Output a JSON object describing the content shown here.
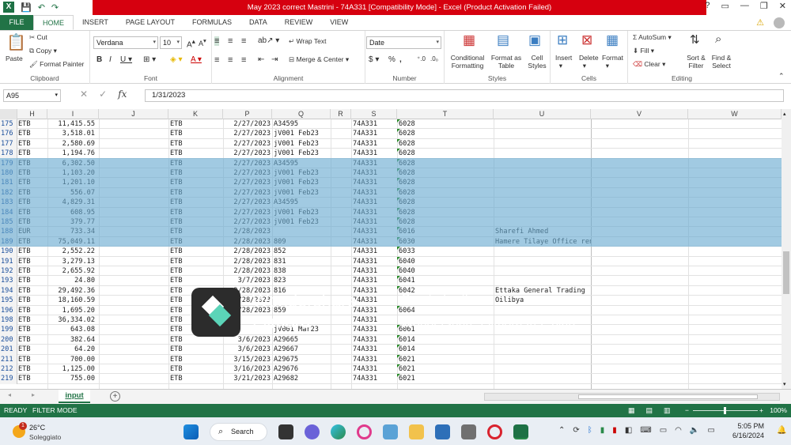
{
  "window": {
    "title": "May 2023 correct Mastrini - 74A331  [Compatibility Mode] - Excel (Product Activation Failed)",
    "controls": [
      "?",
      "▭",
      "—",
      "❐",
      "✕"
    ]
  },
  "tabs": [
    "FILE",
    "HOME",
    "INSERT",
    "PAGE LAYOUT",
    "FORMULAS",
    "DATA",
    "REVIEW",
    "VIEW"
  ],
  "active_tab": "HOME",
  "ribbon": {
    "clipboard": {
      "label": "Clipboard",
      "paste": "Paste",
      "cut": "Cut",
      "copy": "Copy",
      "format_painter": "Format Painter"
    },
    "font": {
      "label": "Font",
      "name": "Verdana",
      "size": "10"
    },
    "alignment": {
      "label": "Alignment",
      "wrap": "Wrap Text",
      "merge": "Merge & Center"
    },
    "number": {
      "label": "Number",
      "format": "Date"
    },
    "styles": {
      "label": "Styles",
      "conditional": "Conditional Formatting",
      "format_table": "Format as Table",
      "cell_styles": "Cell Styles"
    },
    "cells": {
      "label": "Cells",
      "insert": "Insert",
      "delete": "Delete",
      "format": "Format"
    },
    "editing": {
      "label": "Editing",
      "autosum": "AutoSum",
      "fill": "Fill",
      "clear": "Clear",
      "sort": "Sort & Filter",
      "find": "Find & Select"
    }
  },
  "formula_bar": {
    "name_box": "A95",
    "value": "1/31/2023"
  },
  "columns": [
    "H",
    "I",
    "J",
    "K",
    "P",
    "Q",
    "R",
    "S",
    "T",
    "U",
    "V",
    "W"
  ],
  "rows": [
    {
      "n": "175",
      "h": "ETB",
      "i": "11,415.55",
      "k": "ETB",
      "p": "2/27/2023",
      "q": "A34595",
      "s": "74A331",
      "t": "6028",
      "u": ""
    },
    {
      "n": "176",
      "h": "ETB",
      "i": "3,518.01",
      "k": "ETB",
      "p": "2/27/2023",
      "q": "jV001 Feb23",
      "s": "74A331",
      "t": "6028",
      "u": ""
    },
    {
      "n": "177",
      "h": "ETB",
      "i": "2,580.69",
      "k": "ETB",
      "p": "2/27/2023",
      "q": "jV001 Feb23",
      "s": "74A331",
      "t": "6028",
      "u": ""
    },
    {
      "n": "178",
      "h": "ETB",
      "i": "1,194.76",
      "k": "ETB",
      "p": "2/27/2023",
      "q": "jV001 Feb23",
      "s": "74A331",
      "t": "6028",
      "u": ""
    },
    {
      "n": "179",
      "h": "ETB",
      "i": "6,302.50",
      "k": "ETB",
      "p": "2/27/2023",
      "q": "A34595",
      "s": "74A331",
      "t": "6028",
      "u": ""
    },
    {
      "n": "180",
      "h": "ETB",
      "i": "1,103.20",
      "k": "ETB",
      "p": "2/27/2023",
      "q": "jV001 Feb23",
      "s": "74A331",
      "t": "6028",
      "u": ""
    },
    {
      "n": "181",
      "h": "ETB",
      "i": "1,201.10",
      "k": "ETB",
      "p": "2/27/2023",
      "q": "jV001 Feb23",
      "s": "74A331",
      "t": "6028",
      "u": ""
    },
    {
      "n": "182",
      "h": "ETB",
      "i": "556.07",
      "k": "ETB",
      "p": "2/27/2023",
      "q": "jV001 Feb23",
      "s": "74A331",
      "t": "6028",
      "u": ""
    },
    {
      "n": "183",
      "h": "ETB",
      "i": "4,829.31",
      "k": "ETB",
      "p": "2/27/2023",
      "q": "A34595",
      "s": "74A331",
      "t": "6028",
      "u": ""
    },
    {
      "n": "184",
      "h": "ETB",
      "i": "608.95",
      "k": "ETB",
      "p": "2/27/2023",
      "q": "jV001 Feb23",
      "s": "74A331",
      "t": "6028",
      "u": ""
    },
    {
      "n": "185",
      "h": "ETB",
      "i": "379.77",
      "k": "ETB",
      "p": "2/27/2023",
      "q": "jV001 Feb23",
      "s": "74A331",
      "t": "6028",
      "u": ""
    },
    {
      "n": "188",
      "h": "EUR",
      "i": "733.34",
      "k": "ETB",
      "p": "2/28/2023",
      "q": "",
      "s": "74A331",
      "t": "6016",
      "u": "Sharefi Ahmed"
    },
    {
      "n": "189",
      "h": "ETB",
      "i": "75,049.11",
      "k": "ETB",
      "p": "2/28/2023",
      "q": "809",
      "s": "74A331",
      "t": "6030",
      "u": "Hamere Tilaye Office rent"
    },
    {
      "n": "190",
      "h": "ETB",
      "i": "2,552.22",
      "k": "ETB",
      "p": "2/28/2023",
      "q": "852",
      "s": "74A331",
      "t": "6033",
      "u": ""
    },
    {
      "n": "191",
      "h": "ETB",
      "i": "3,279.13",
      "k": "ETB",
      "p": "2/28/2023",
      "q": "831",
      "s": "74A331",
      "t": "6040",
      "u": ""
    },
    {
      "n": "192",
      "h": "ETB",
      "i": "2,655.92",
      "k": "ETB",
      "p": "2/28/2023",
      "q": "838",
      "s": "74A331",
      "t": "6040",
      "u": ""
    },
    {
      "n": "193",
      "h": "ETB",
      "i": "24.80",
      "k": "ETB",
      "p": "3/7/2023",
      "q": "823",
      "s": "74A331",
      "t": "6041",
      "u": ""
    },
    {
      "n": "194",
      "h": "ETB",
      "i": "29,492.36",
      "k": "ETB",
      "p": "2/28/2023",
      "q": "816",
      "s": "74A331",
      "t": "6042",
      "u": "Ettaka General Trading"
    },
    {
      "n": "195",
      "h": "ETB",
      "i": "18,160.59",
      "k": "ETB",
      "p": "2/28/2023",
      "q": "",
      "s": "74A331",
      "t": "",
      "u": "Oilibya"
    },
    {
      "n": "196",
      "h": "ETB",
      "i": "1,695.20",
      "k": "ETB",
      "p": "2/28/2023",
      "q": "859",
      "s": "74A331",
      "t": "6064",
      "u": ""
    },
    {
      "n": "198",
      "h": "ETB",
      "i": "36,334.02",
      "k": "ETB",
      "p": "",
      "q": "",
      "s": "74A331",
      "t": "",
      "u": ""
    },
    {
      "n": "199",
      "h": "ETB",
      "i": "643.08",
      "k": "ETB",
      "p": "",
      "q": "jV001 Mar23",
      "s": "74A331",
      "t": "6061",
      "u": ""
    },
    {
      "n": "200",
      "h": "ETB",
      "i": "382.64",
      "k": "ETB",
      "p": "3/6/2023",
      "q": "A29665",
      "s": "74A331",
      "t": "6014",
      "u": ""
    },
    {
      "n": "201",
      "h": "ETB",
      "i": "64.20",
      "k": "ETB",
      "p": "3/6/2023",
      "q": "A29667",
      "s": "74A331",
      "t": "6014",
      "u": ""
    },
    {
      "n": "211",
      "h": "ETB",
      "i": "700.00",
      "k": "ETB",
      "p": "3/15/2023",
      "q": "A29675",
      "s": "74A331",
      "t": "6021",
      "u": ""
    },
    {
      "n": "212",
      "h": "ETB",
      "i": "1,125.00",
      "k": "ETB",
      "p": "3/16/2023",
      "q": "A29676",
      "s": "74A331",
      "t": "6021",
      "u": ""
    },
    {
      "n": "219",
      "h": "ETB",
      "i": "755.00",
      "k": "ETB",
      "p": "3/21/2023",
      "q": "A29682",
      "s": "74A331",
      "t": "6021",
      "u": ""
    }
  ],
  "watermark": {
    "brand1": "Wondershare",
    "brand2": "Filmora",
    "line1": "Created with",
    "line2": "Wondershare Filmora free plan"
  },
  "sheet_tab": "input",
  "status": {
    "mode": "READY",
    "filter": "FILTER MODE",
    "zoom": "100%"
  },
  "taskbar": {
    "temp": "26°C",
    "condition": "Soleggiato",
    "badge": "1",
    "search": "Search",
    "time": "5:05 PM",
    "date": "6/16/2024"
  },
  "colors": {
    "excel_green": "#217346",
    "title_red": "#d6000f",
    "selection_blue": "#68a9d1"
  }
}
